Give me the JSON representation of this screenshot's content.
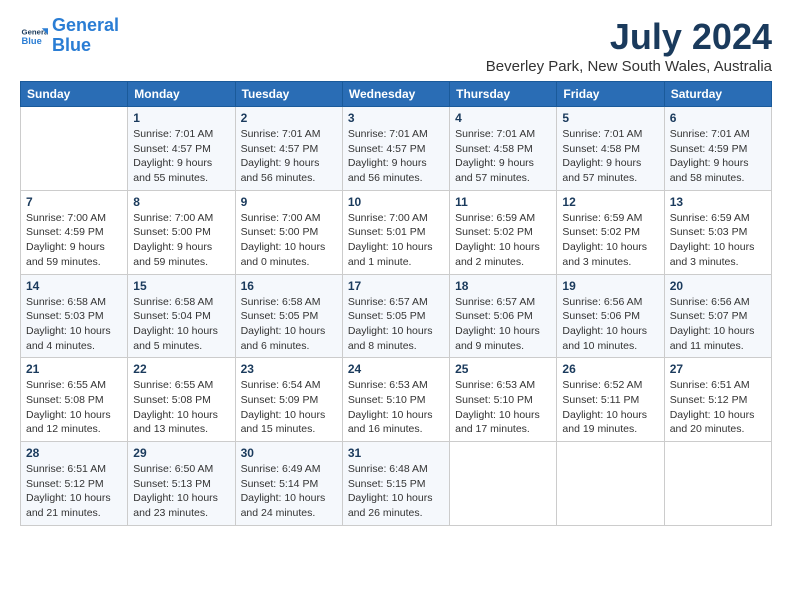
{
  "logo": {
    "text_general": "General",
    "text_blue": "Blue"
  },
  "title": "July 2024",
  "location": "Beverley Park, New South Wales, Australia",
  "days_of_week": [
    "Sunday",
    "Monday",
    "Tuesday",
    "Wednesday",
    "Thursday",
    "Friday",
    "Saturday"
  ],
  "weeks": [
    [
      {
        "day": "",
        "info": ""
      },
      {
        "day": "1",
        "info": "Sunrise: 7:01 AM\nSunset: 4:57 PM\nDaylight: 9 hours\nand 55 minutes."
      },
      {
        "day": "2",
        "info": "Sunrise: 7:01 AM\nSunset: 4:57 PM\nDaylight: 9 hours\nand 56 minutes."
      },
      {
        "day": "3",
        "info": "Sunrise: 7:01 AM\nSunset: 4:57 PM\nDaylight: 9 hours\nand 56 minutes."
      },
      {
        "day": "4",
        "info": "Sunrise: 7:01 AM\nSunset: 4:58 PM\nDaylight: 9 hours\nand 57 minutes."
      },
      {
        "day": "5",
        "info": "Sunrise: 7:01 AM\nSunset: 4:58 PM\nDaylight: 9 hours\nand 57 minutes."
      },
      {
        "day": "6",
        "info": "Sunrise: 7:01 AM\nSunset: 4:59 PM\nDaylight: 9 hours\nand 58 minutes."
      }
    ],
    [
      {
        "day": "7",
        "info": "Sunrise: 7:00 AM\nSunset: 4:59 PM\nDaylight: 9 hours\nand 59 minutes."
      },
      {
        "day": "8",
        "info": "Sunrise: 7:00 AM\nSunset: 5:00 PM\nDaylight: 9 hours\nand 59 minutes."
      },
      {
        "day": "9",
        "info": "Sunrise: 7:00 AM\nSunset: 5:00 PM\nDaylight: 10 hours\nand 0 minutes."
      },
      {
        "day": "10",
        "info": "Sunrise: 7:00 AM\nSunset: 5:01 PM\nDaylight: 10 hours\nand 1 minute."
      },
      {
        "day": "11",
        "info": "Sunrise: 6:59 AM\nSunset: 5:02 PM\nDaylight: 10 hours\nand 2 minutes."
      },
      {
        "day": "12",
        "info": "Sunrise: 6:59 AM\nSunset: 5:02 PM\nDaylight: 10 hours\nand 3 minutes."
      },
      {
        "day": "13",
        "info": "Sunrise: 6:59 AM\nSunset: 5:03 PM\nDaylight: 10 hours\nand 3 minutes."
      }
    ],
    [
      {
        "day": "14",
        "info": "Sunrise: 6:58 AM\nSunset: 5:03 PM\nDaylight: 10 hours\nand 4 minutes."
      },
      {
        "day": "15",
        "info": "Sunrise: 6:58 AM\nSunset: 5:04 PM\nDaylight: 10 hours\nand 5 minutes."
      },
      {
        "day": "16",
        "info": "Sunrise: 6:58 AM\nSunset: 5:05 PM\nDaylight: 10 hours\nand 6 minutes."
      },
      {
        "day": "17",
        "info": "Sunrise: 6:57 AM\nSunset: 5:05 PM\nDaylight: 10 hours\nand 8 minutes."
      },
      {
        "day": "18",
        "info": "Sunrise: 6:57 AM\nSunset: 5:06 PM\nDaylight: 10 hours\nand 9 minutes."
      },
      {
        "day": "19",
        "info": "Sunrise: 6:56 AM\nSunset: 5:06 PM\nDaylight: 10 hours\nand 10 minutes."
      },
      {
        "day": "20",
        "info": "Sunrise: 6:56 AM\nSunset: 5:07 PM\nDaylight: 10 hours\nand 11 minutes."
      }
    ],
    [
      {
        "day": "21",
        "info": "Sunrise: 6:55 AM\nSunset: 5:08 PM\nDaylight: 10 hours\nand 12 minutes."
      },
      {
        "day": "22",
        "info": "Sunrise: 6:55 AM\nSunset: 5:08 PM\nDaylight: 10 hours\nand 13 minutes."
      },
      {
        "day": "23",
        "info": "Sunrise: 6:54 AM\nSunset: 5:09 PM\nDaylight: 10 hours\nand 15 minutes."
      },
      {
        "day": "24",
        "info": "Sunrise: 6:53 AM\nSunset: 5:10 PM\nDaylight: 10 hours\nand 16 minutes."
      },
      {
        "day": "25",
        "info": "Sunrise: 6:53 AM\nSunset: 5:10 PM\nDaylight: 10 hours\nand 17 minutes."
      },
      {
        "day": "26",
        "info": "Sunrise: 6:52 AM\nSunset: 5:11 PM\nDaylight: 10 hours\nand 19 minutes."
      },
      {
        "day": "27",
        "info": "Sunrise: 6:51 AM\nSunset: 5:12 PM\nDaylight: 10 hours\nand 20 minutes."
      }
    ],
    [
      {
        "day": "28",
        "info": "Sunrise: 6:51 AM\nSunset: 5:12 PM\nDaylight: 10 hours\nand 21 minutes."
      },
      {
        "day": "29",
        "info": "Sunrise: 6:50 AM\nSunset: 5:13 PM\nDaylight: 10 hours\nand 23 minutes."
      },
      {
        "day": "30",
        "info": "Sunrise: 6:49 AM\nSunset: 5:14 PM\nDaylight: 10 hours\nand 24 minutes."
      },
      {
        "day": "31",
        "info": "Sunrise: 6:48 AM\nSunset: 5:15 PM\nDaylight: 10 hours\nand 26 minutes."
      },
      {
        "day": "",
        "info": ""
      },
      {
        "day": "",
        "info": ""
      },
      {
        "day": "",
        "info": ""
      }
    ]
  ]
}
